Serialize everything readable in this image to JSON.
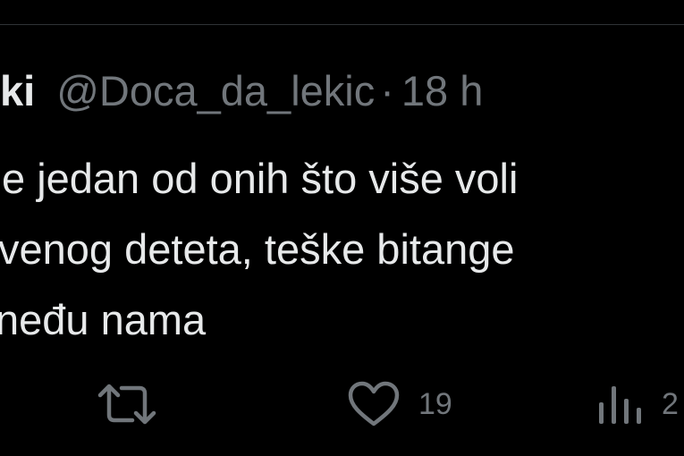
{
  "tweet": {
    "author_name": "ki",
    "handle": "@Doca_da_lekic",
    "separator": "·",
    "time": "18 h",
    "text_lines": [
      "e jedan od onih što više voli",
      "venog deteta, teške bitange",
      "neđu nama"
    ]
  },
  "actions": {
    "retweet": {
      "icon": "retweet-icon",
      "count": ""
    },
    "like": {
      "icon": "heart-icon",
      "count": "19"
    },
    "views": {
      "icon": "views-icon",
      "count": "2"
    }
  },
  "colors": {
    "background": "#000000",
    "text_primary": "#e7e9ea",
    "text_secondary": "#71767b",
    "divider": "#2f3336"
  }
}
